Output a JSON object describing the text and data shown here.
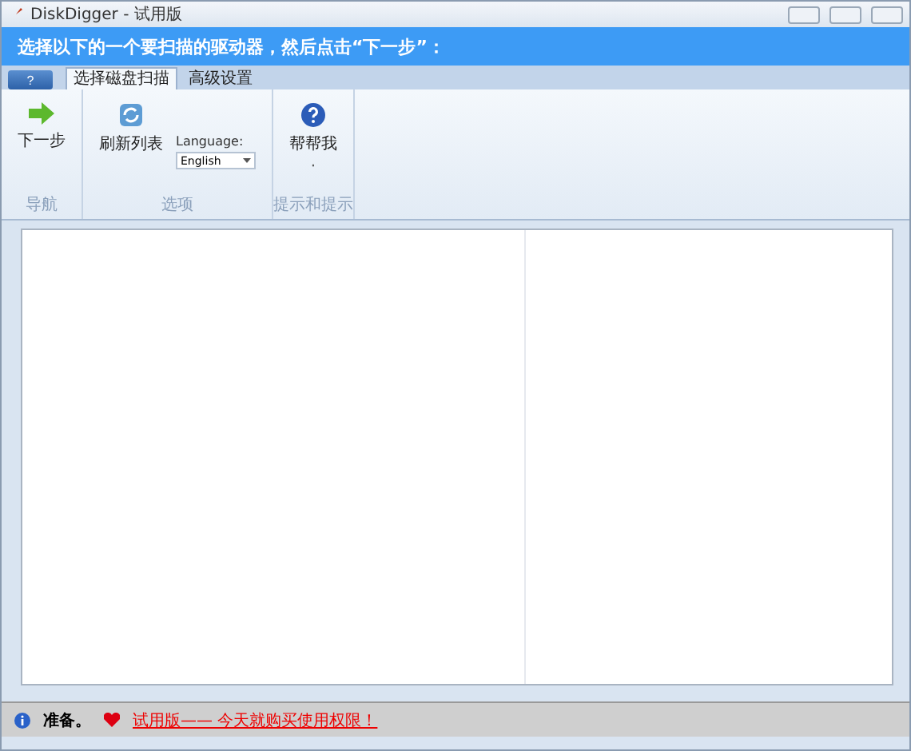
{
  "window": {
    "title": "DiskDigger - 试用版"
  },
  "header": {
    "instruction": "选择以下的一个要扫描的驱动器，然后点击“下一步”："
  },
  "app_button": {
    "label": "?"
  },
  "tabs": [
    {
      "label": "选择磁盘扫描",
      "selected": true
    },
    {
      "label": "高级设置",
      "selected": false
    }
  ],
  "ribbon": {
    "groups": [
      {
        "label": "导航",
        "items": [
          {
            "kind": "big_button",
            "label": "下一步"
          }
        ]
      },
      {
        "label": "选项",
        "items": [
          {
            "kind": "big_button",
            "label": "刷新列表"
          },
          {
            "kind": "dropdown",
            "label": "Language:",
            "value": "English"
          }
        ]
      },
      {
        "label": "提示和提示",
        "items": [
          {
            "kind": "big_button",
            "label": "帮帮我",
            "sub": "·"
          }
        ]
      }
    ]
  },
  "status_bar": {
    "status": "准备。",
    "link": "试用版—— 今天就购买使用权限！"
  }
}
